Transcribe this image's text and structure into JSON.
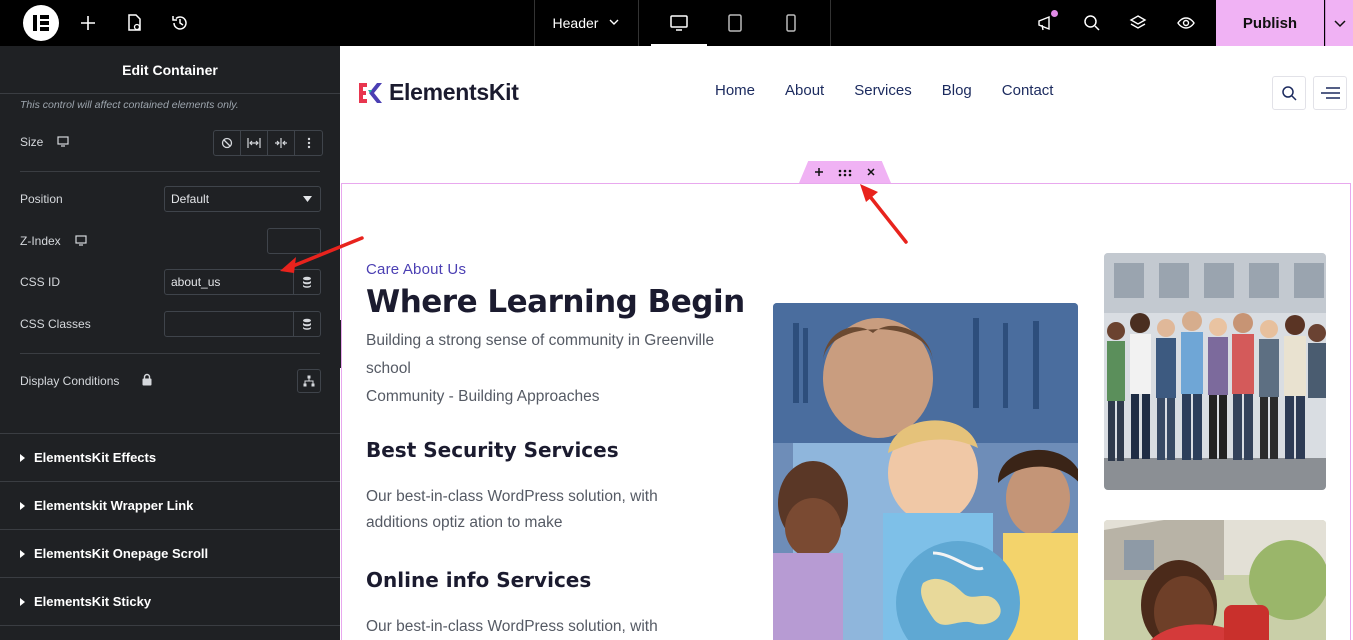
{
  "topbar": {
    "document_name": "Header",
    "publish_label": "Publish",
    "icons": [
      "elementor-logo-icon",
      "add-icon",
      "site-settings-icon",
      "history-icon",
      "chevron-down-icon",
      "desktop-icon",
      "tablet-icon",
      "mobile-icon",
      "notifications-icon",
      "search-icon",
      "structure-icon",
      "preview-icon"
    ]
  },
  "panel": {
    "title": "Edit Container",
    "note": "This control will affect contained elements only.",
    "size_label": "Size",
    "position_label": "Position",
    "position_value": "Default",
    "zindex_label": "Z-Index",
    "zindex_value": "",
    "css_id_label": "CSS ID",
    "css_id_value": "about_us",
    "css_classes_label": "CSS Classes",
    "css_classes_value": "",
    "display_conditions_label": "Display Conditions",
    "sections": [
      {
        "label": "ElementsKit Effects"
      },
      {
        "label": "Elementskit Wrapper Link"
      },
      {
        "label": "ElementsKit Onepage Scroll"
      },
      {
        "label": "ElementsKit Sticky"
      }
    ]
  },
  "site": {
    "logo_text": "ElementsKit",
    "nav": [
      "Home",
      "About",
      "Services",
      "Blog",
      "Contact"
    ],
    "eyebrow": "Care About Us",
    "heading": "Where Learning Begin",
    "intro_line1": "Building a strong sense of community in Greenville",
    "intro_line2": "school",
    "intro_line3": "Community - Building Approaches",
    "service1_title": "Best Security Services",
    "service1_line1": "Our best-in-class WordPress solution, with",
    "service1_line2": "additions optiz ation to make",
    "service2_title": "Online info Services",
    "service2_line1": "Our best-in-class WordPress solution, with"
  },
  "colors": {
    "accent_pink": "#f0b2f4",
    "panel_bg": "#1f2124",
    "nav_blue": "#1b2a5e",
    "eyebrow_purple": "#4b3fb3",
    "annotation_red": "#e8231d"
  }
}
